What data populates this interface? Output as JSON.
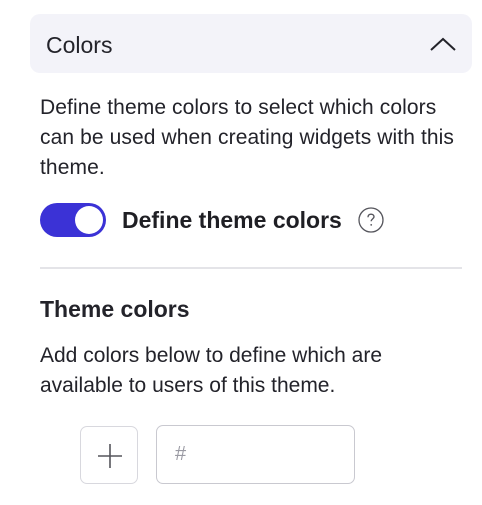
{
  "panel": {
    "title": "Colors",
    "expanded": true,
    "description": "Define theme colors to select which colors can be used when creating widgets with this theme.",
    "toggle": {
      "label": "Define theme colors",
      "on": true
    },
    "help_icon": "question-circle-icon",
    "collapse_icon": "chevron-up-icon"
  },
  "theme_colors": {
    "title": "Theme colors",
    "description": "Add colors below to define which are available to users of this theme.",
    "add_icon": "plus-icon",
    "hex_input": {
      "value": "",
      "placeholder": "#"
    }
  },
  "colors": {
    "accent": "#3b32d6",
    "header_bg": "#f3f3f9",
    "divider": "#e4e4e8"
  }
}
